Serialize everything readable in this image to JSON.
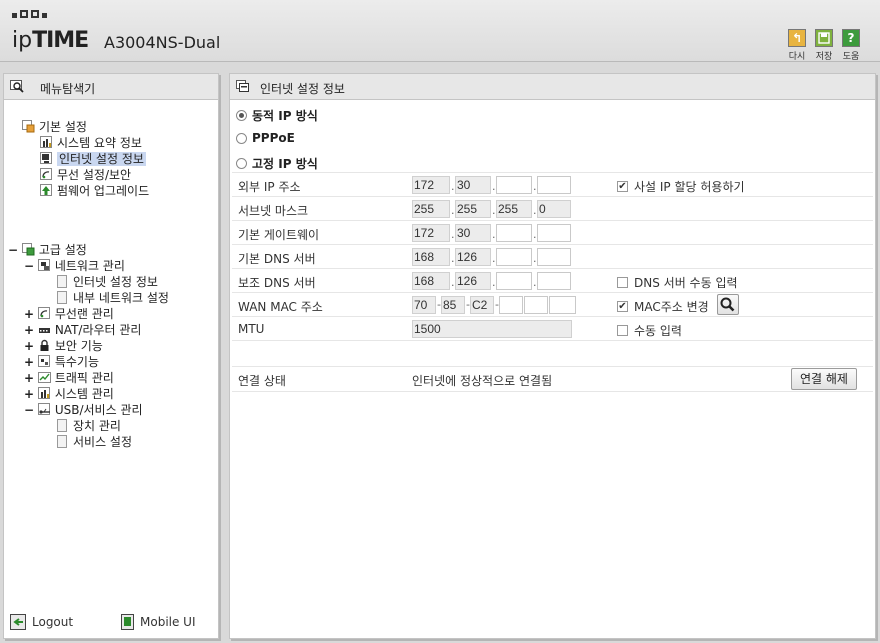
{
  "header": {
    "brand_prefix": "ip",
    "brand_bold": "TIME",
    "model": "A3004NS-Dual",
    "buttons": [
      {
        "label": "다시",
        "icon": "undo-icon",
        "color": "#e8b440"
      },
      {
        "label": "저장",
        "icon": "save-icon",
        "color": "#7fb23e"
      },
      {
        "label": "도움",
        "icon": "help-icon",
        "color": "#3d9b3d"
      }
    ]
  },
  "nav": {
    "title": "메뉴탐색기",
    "basic": {
      "label": "기본 설정",
      "items": [
        "시스템 요약 정보",
        "인터넷 설정 정보",
        "무선 설정/보안",
        "펌웨어 업그레이드"
      ]
    },
    "advanced": {
      "label": "고급 설정",
      "groups": [
        {
          "label": "네트워크 관리",
          "expander": "−",
          "children": [
            "인터넷 설정 정보",
            "내부 네트워크 설정"
          ]
        },
        {
          "label": "무선랜 관리",
          "expander": "+"
        },
        {
          "label": "NAT/라우터 관리",
          "expander": "+"
        },
        {
          "label": "보안 기능",
          "expander": "+"
        },
        {
          "label": "특수기능",
          "expander": "+"
        },
        {
          "label": "트래픽 관리",
          "expander": "+"
        },
        {
          "label": "시스템 관리",
          "expander": "+"
        },
        {
          "label": "USB/서비스 관리",
          "expander": "−",
          "children": [
            "장치 관리",
            "서비스 설정"
          ]
        }
      ]
    },
    "footer": {
      "logout": "Logout",
      "mobile": "Mobile UI"
    }
  },
  "main": {
    "title": "인터넷 설정 정보",
    "modes": [
      {
        "label": "동적 IP 방식",
        "selected": true
      },
      {
        "label": "PPPoE",
        "selected": false
      },
      {
        "label": "고정 IP 방식",
        "selected": false
      }
    ],
    "fields": {
      "external_ip": {
        "label": "외부 IP 주소",
        "octets": [
          "172",
          "30",
          "",
          ""
        ],
        "option": "사설 IP 할당 허용하기",
        "option_checked": true
      },
      "subnet": {
        "label": "서브넷 마스크",
        "octets": [
          "255",
          "255",
          "255",
          "0"
        ]
      },
      "gateway": {
        "label": "기본 게이트웨이",
        "octets": [
          "172",
          "30",
          "",
          ""
        ]
      },
      "dns1": {
        "label": "기본 DNS 서버",
        "octets": [
          "168",
          "126",
          "",
          ""
        ]
      },
      "dns2": {
        "label": "보조 DNS 서버",
        "octets": [
          "168",
          "126",
          "",
          ""
        ],
        "option": "DNS 서버 수동 입력",
        "option_checked": false
      },
      "wan_mac": {
        "label": "WAN MAC 주소",
        "parts": [
          "70",
          "85",
          "C2",
          "",
          "",
          ""
        ],
        "option": "MAC주소 변경",
        "option_checked": true
      },
      "mtu": {
        "label": "MTU",
        "value": "1500",
        "option": "수동 입력",
        "option_checked": false
      }
    },
    "status": {
      "label": "연결 상태",
      "value": "인터넷에 정상적으로 연결됨",
      "button": "연결 해제"
    }
  }
}
